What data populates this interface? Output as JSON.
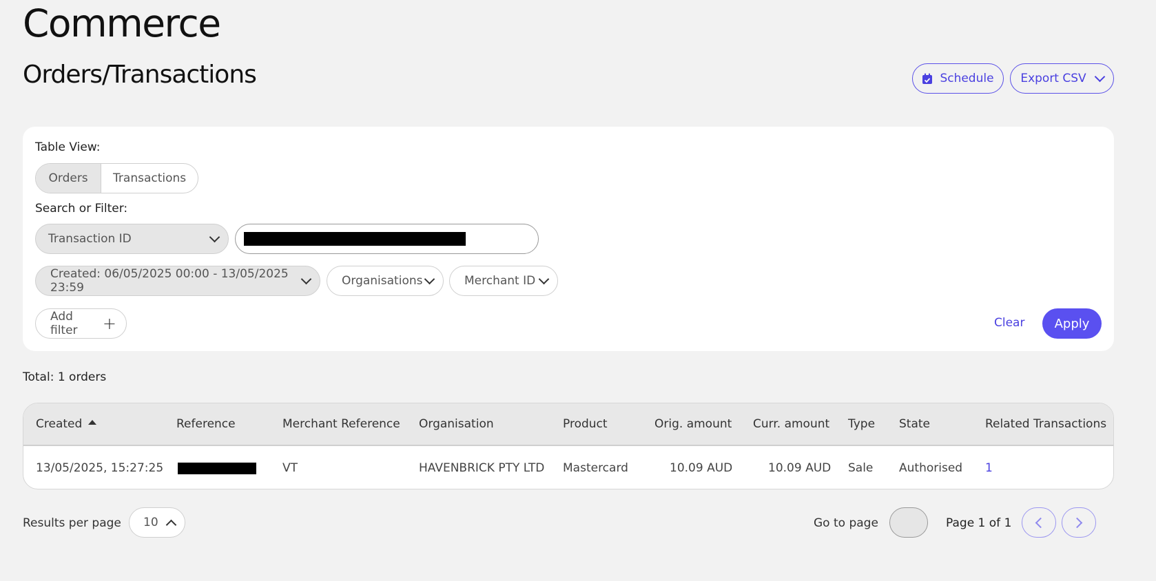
{
  "app_title": "Commerce",
  "page_title": "Orders/Transactions",
  "header_actions": {
    "schedule_label": "Schedule",
    "export_label": "Export CSV"
  },
  "filters": {
    "table_view_label": "Table View:",
    "views": [
      "Orders",
      "Transactions"
    ],
    "active_view": "Orders",
    "search_label": "Search or Filter:",
    "search_field": "Transaction ID",
    "created_filter": "Created: 06/05/2025 00:00 - 13/05/2025 23:59",
    "organisations_filter": "Organisations",
    "merchant_filter": "Merchant ID",
    "add_filter_label": "Add filter",
    "clear_label": "Clear",
    "apply_label": "Apply"
  },
  "total_text": "Total: 1 orders",
  "table": {
    "columns": [
      "Created",
      "Reference",
      "Merchant Reference",
      "Organisation",
      "Product",
      "Orig. amount",
      "Curr. amount",
      "Type",
      "State",
      "Related Transactions"
    ],
    "rows": [
      {
        "created": "13/05/2025, 15:27:25",
        "merchant_reference": "VT",
        "organisation": "HAVENBRICK PTY LTD",
        "product": "Mastercard",
        "orig_amount": "10.09 AUD",
        "curr_amount": "10.09 AUD",
        "type": "Sale",
        "state": "Authorised",
        "related_transactions": "1"
      }
    ]
  },
  "pagination": {
    "results_per_page_label": "Results per page",
    "results_per_page": "10",
    "go_to_page_label": "Go to page",
    "page_text": "Page 1 of 1"
  },
  "colors": {
    "accent": "#5a50f0",
    "background": "#f2f2f2"
  }
}
